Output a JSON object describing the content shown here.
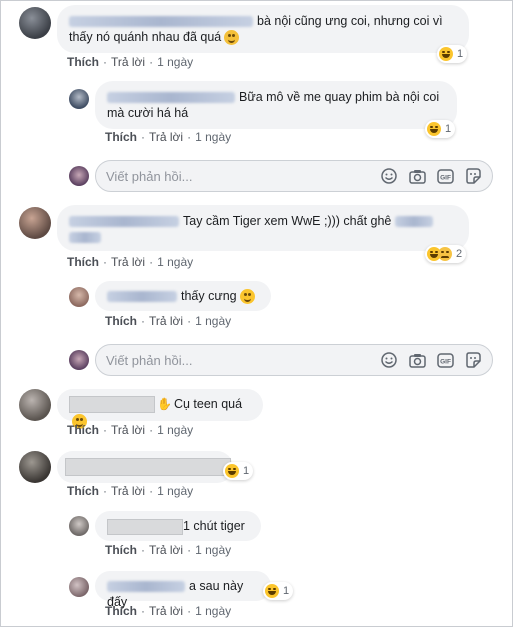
{
  "actions": {
    "like": "Thích",
    "reply": "Trả lời",
    "time": "1 ngày",
    "sep": "·"
  },
  "reply_placeholder": "Viết phản hồi...",
  "gif_label": "GIF",
  "comments": {
    "c1": {
      "line1": "bà nội cũng ưng coi, nhưng coi vì",
      "line2": "thấy nó quánh nhau đã quá",
      "reactions": "1"
    },
    "r1": {
      "line1": "Bữa mô về me quay phim bà nội coi",
      "line2": "mà cười há há",
      "reactions": "1"
    },
    "c2": {
      "text": "Tay cầm Tiger xem WwE ;))) chất ghê",
      "reactions": "2"
    },
    "r2": {
      "text": "thấy cưng"
    },
    "c3": {
      "text": "Cụ teen quá"
    },
    "c4": {
      "reactions": "1"
    },
    "r3": {
      "text": "1 chút tiger"
    },
    "r4": {
      "text": "a sau này đấy",
      "reactions": "1"
    }
  },
  "icons": [
    "emoji-icon",
    "camera-icon",
    "gif-icon",
    "sticker-icon"
  ]
}
